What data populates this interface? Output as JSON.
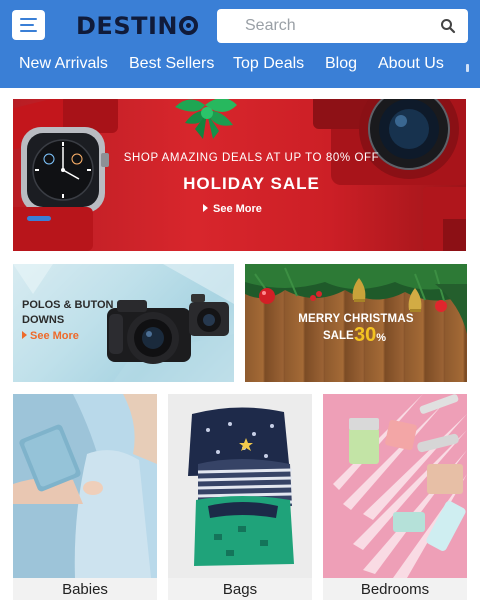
{
  "header": {
    "brand": "DESTINO",
    "brand_text": "DESTIN",
    "search_placeholder": "Search",
    "accent_color": "#3a7fd6",
    "icons": [
      "menu-icon",
      "search-icon"
    ]
  },
  "nav": {
    "items": [
      "New Arrivals",
      "Best Sellers",
      "Top Deals",
      "Blog",
      "About Us"
    ]
  },
  "hero": {
    "subtitle": "SHOP AMAZING DEALS AT UP TO 80% OFF",
    "title": "HOLIDAY SALE",
    "link": "See More",
    "slide_index": 1
  },
  "promos": {
    "left": {
      "title_line1": "POLOS & BUTON",
      "title_line2": "DOWNS",
      "link": "See More"
    },
    "right": {
      "line1": "MERRY CHRISTMAS",
      "line2": "SALE",
      "percent": "30",
      "percent_sign": "%"
    }
  },
  "categories": [
    {
      "label": "Babies"
    },
    {
      "label": "Bags"
    },
    {
      "label": "Bedrooms"
    }
  ]
}
